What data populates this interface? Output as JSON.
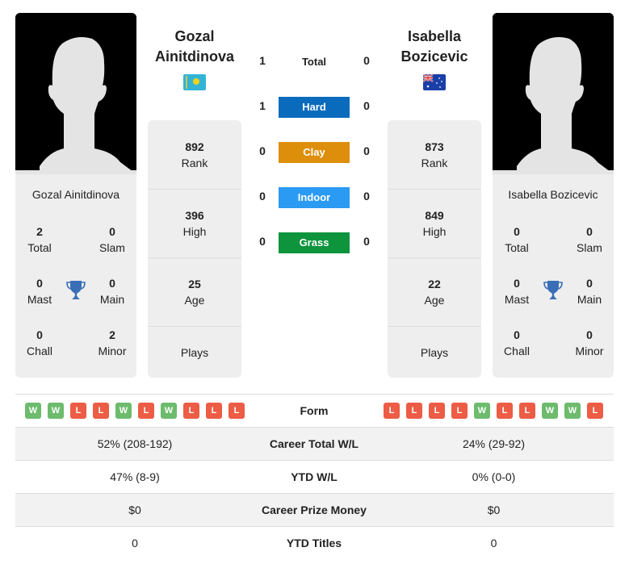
{
  "player1": {
    "name_line1": "Gozal",
    "name_line2": "Ainitdinova",
    "full_name": "Gozal Ainitdinova",
    "flag": "kazakhstan-flag",
    "titles": {
      "total": "2",
      "slam": "0",
      "mast": "0",
      "main": "0",
      "chall": "0",
      "minor": "2"
    },
    "rank": "892",
    "high": "396",
    "age": "25",
    "plays": ""
  },
  "player2": {
    "name_line1": "Isabella",
    "name_line2": "Bozicevic",
    "full_name": "Isabella Bozicevic",
    "flag": "australia-flag",
    "titles": {
      "total": "0",
      "slam": "0",
      "mast": "0",
      "main": "0",
      "chall": "0",
      "minor": "0"
    },
    "rank": "873",
    "high": "849",
    "age": "22",
    "plays": ""
  },
  "labels": {
    "total": "Total",
    "slam": "Slam",
    "mast": "Mast",
    "main": "Main",
    "chall": "Chall",
    "minor": "Minor",
    "rank": "Rank",
    "high": "High",
    "age": "Age",
    "plays": "Plays"
  },
  "h2h": {
    "total_label": "Total",
    "p1_total": "1",
    "p2_total": "0",
    "surfaces": [
      {
        "label": "Hard",
        "p1": "1",
        "p2": "0",
        "color": "#0a6bbd"
      },
      {
        "label": "Clay",
        "p1": "0",
        "p2": "0",
        "color": "#dd8e0b"
      },
      {
        "label": "Indoor",
        "p1": "0",
        "p2": "0",
        "color": "#2b9af3"
      },
      {
        "label": "Grass",
        "p1": "0",
        "p2": "0",
        "color": "#0e943d"
      }
    ]
  },
  "comparison": {
    "form_label": "Form",
    "p1_form": [
      "W",
      "W",
      "L",
      "L",
      "W",
      "L",
      "W",
      "L",
      "L",
      "L"
    ],
    "p2_form": [
      "L",
      "L",
      "L",
      "L",
      "W",
      "L",
      "L",
      "W",
      "W",
      "L"
    ],
    "rows": [
      {
        "label": "Career Total W/L",
        "p1": "52% (208-192)",
        "p2": "24% (29-92)"
      },
      {
        "label": "YTD W/L",
        "p1": "47% (8-9)",
        "p2": "0% (0-0)"
      },
      {
        "label": "Career Prize Money",
        "p1": "$0",
        "p2": "$0"
      },
      {
        "label": "YTD Titles",
        "p1": "0",
        "p2": "0"
      }
    ]
  },
  "colors": {
    "win": "#6dbb6d",
    "loss": "#ed5c45",
    "trophy": "#3a6fb8"
  }
}
